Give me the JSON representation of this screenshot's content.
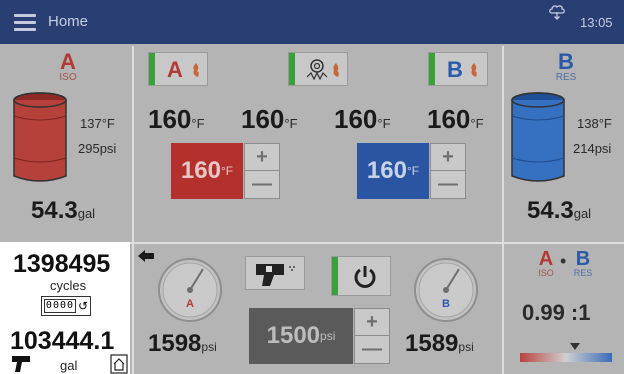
{
  "header": {
    "title": "Home",
    "time": "13:05",
    "menu_icon": "hamburger-menu-icon",
    "cloud_icon": "cloud-download-icon"
  },
  "iso": {
    "letter": "A",
    "sub": "ISO",
    "temp": "137",
    "temp_unit": "°F",
    "pressure": "295",
    "pressure_unit": "psi",
    "volume": "54.3",
    "volume_unit": "gal",
    "color": "#c0342f"
  },
  "res": {
    "letter": "B",
    "sub": "RES",
    "temp": "138",
    "temp_unit": "°F",
    "pressure": "214",
    "pressure_unit": "psi",
    "volume": "54.3",
    "volume_unit": "gal",
    "color": "#2a62b8"
  },
  "heaters": {
    "a": {
      "letter": "A",
      "value": "160",
      "unit": "°F"
    },
    "hose": {
      "value": "160",
      "unit": "°F"
    },
    "hose2": {
      "value": "160",
      "unit": "°F"
    },
    "b": {
      "letter": "B",
      "value": "160",
      "unit": "°F"
    }
  },
  "setpoints": {
    "a": {
      "value": "160",
      "unit": "°F",
      "color": "#c0342f"
    },
    "b": {
      "value": "160",
      "unit": "°F",
      "color": "#2a62b8"
    }
  },
  "counter": {
    "cycles": "1398495",
    "cycles_label": "cycles",
    "reset_digits": "0000",
    "gallons": "103444.1",
    "gallons_label": "gal"
  },
  "gauges": {
    "a": {
      "letter": "A",
      "value": "1598",
      "unit": "psi"
    },
    "b": {
      "letter": "B",
      "value": "1589",
      "unit": "psi"
    }
  },
  "pressure_setpoint": {
    "value": "1500",
    "unit": "psi"
  },
  "ratio": {
    "a": "A",
    "a_sub": "ISO",
    "dot": "•",
    "b": "B",
    "b_sub": "RES",
    "value": "0.99 :1"
  }
}
